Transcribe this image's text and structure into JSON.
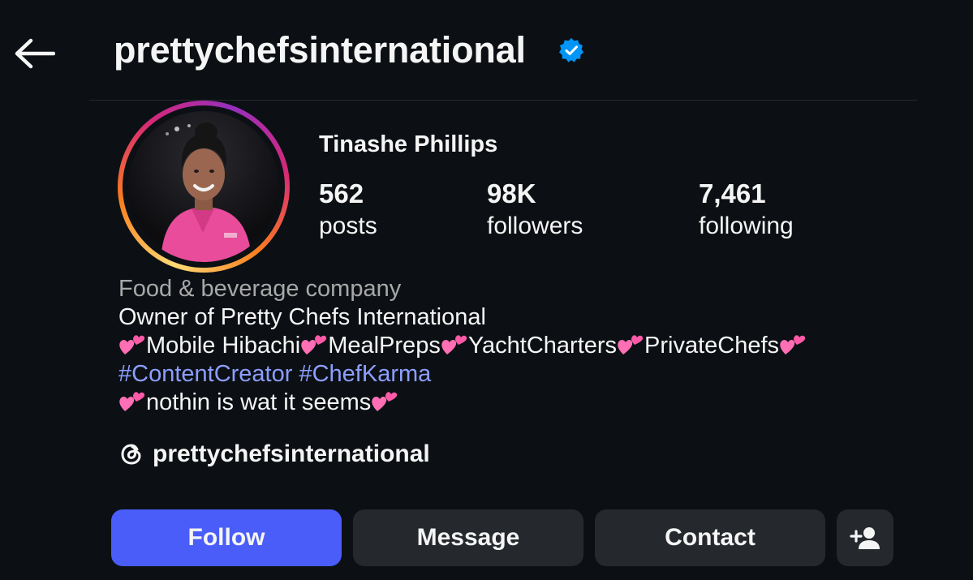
{
  "header": {
    "username": "prettychefsinternational",
    "verified": true
  },
  "profile": {
    "full_name": "Tinashe Phillips",
    "stats": [
      {
        "value": "562",
        "label": "posts"
      },
      {
        "value": "98K",
        "label": "followers"
      },
      {
        "value": "7,461",
        "label": "following"
      }
    ]
  },
  "bio": {
    "category": "Food & beverage company",
    "line1": "Owner of Pretty Chefs International",
    "services": [
      "Mobile Hibachi",
      "MealPreps",
      "YachtCharters",
      "PrivateChefs"
    ],
    "hashtags": [
      "#ContentCreator",
      "#ChefKarma"
    ],
    "tagline": "nothin is wat it seems"
  },
  "threads": {
    "handle": "prettychefsinternational"
  },
  "actions": {
    "follow_label": "Follow",
    "message_label": "Message",
    "contact_label": "Contact"
  },
  "icons": {
    "back": "arrow-left-icon",
    "verified": "verified-badge-icon",
    "heart": "two-hearts-emoji",
    "threads": "threads-icon",
    "add_user": "person-add-icon"
  },
  "colors": {
    "background": "#0c1014",
    "follow_button": "#4a5df9",
    "secondary_button": "#25292e",
    "hashtag": "#8c9eff",
    "verified": "#0095f6",
    "category_text": "#a8a8a8"
  }
}
